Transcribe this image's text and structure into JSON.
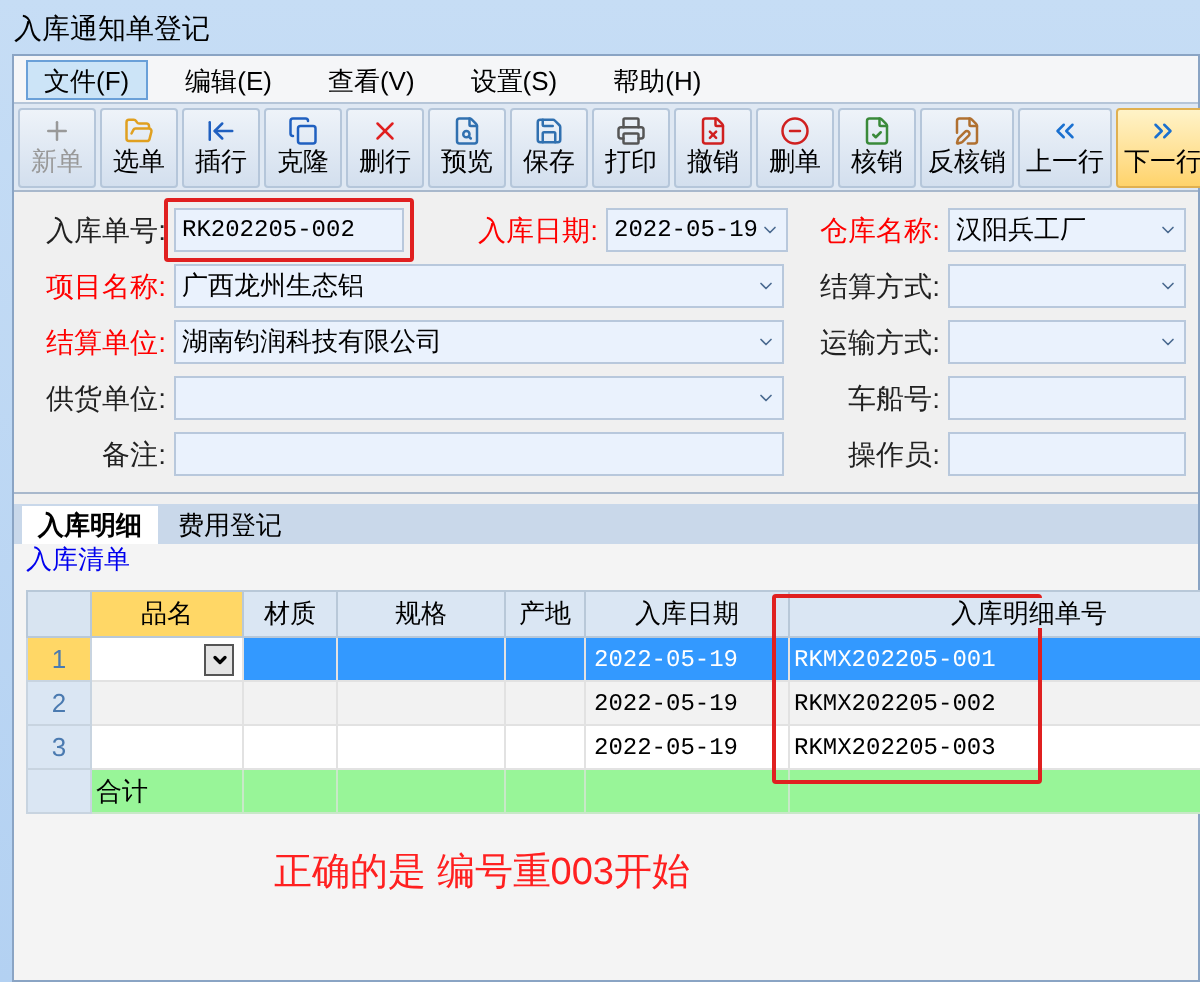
{
  "window": {
    "title": "入库通知单登记"
  },
  "menu": [
    {
      "label": "文件(F)",
      "selected": true
    },
    {
      "label": "编辑(E)",
      "selected": false
    },
    {
      "label": "查看(V)",
      "selected": false
    },
    {
      "label": "设置(S)",
      "selected": false
    },
    {
      "label": "帮助(H)",
      "selected": false
    }
  ],
  "toolbar": [
    {
      "label": "新单",
      "kind": "new",
      "disabled": true,
      "selected": false
    },
    {
      "label": "选单",
      "kind": "folder",
      "disabled": false,
      "selected": false
    },
    {
      "label": "插行",
      "kind": "insert",
      "disabled": false,
      "selected": false
    },
    {
      "label": "克隆",
      "kind": "clone",
      "disabled": false,
      "selected": false
    },
    {
      "label": "删行",
      "kind": "delrow",
      "disabled": false,
      "selected": false
    },
    {
      "label": "预览",
      "kind": "preview",
      "disabled": false,
      "selected": false
    },
    {
      "label": "保存",
      "kind": "save",
      "disabled": false,
      "selected": false
    },
    {
      "label": "打印",
      "kind": "print",
      "disabled": false,
      "selected": false
    },
    {
      "label": "撤销",
      "kind": "undo",
      "disabled": false,
      "selected": false
    },
    {
      "label": "删单",
      "kind": "delete",
      "disabled": false,
      "selected": false
    },
    {
      "label": "核销",
      "kind": "verify",
      "disabled": false,
      "selected": false
    },
    {
      "label": "反核销",
      "kind": "unverify",
      "disabled": false,
      "selected": false
    },
    {
      "label": "上一行",
      "kind": "prev",
      "disabled": false,
      "selected": false
    },
    {
      "label": "下一行",
      "kind": "next",
      "disabled": false,
      "selected": true
    }
  ],
  "form": {
    "rows": [
      {
        "fields": [
          {
            "label": "入库单号:",
            "required": false,
            "value": "RK202205-002",
            "kind": "text",
            "boxed": true
          },
          {
            "label": "入库日期:",
            "required": true,
            "value": "2022-05-19",
            "kind": "combo",
            "boxed": false
          }
        ],
        "side": {
          "label": "仓库名称:",
          "required": true,
          "value": "汉阳兵工厂",
          "kind": "combo"
        }
      },
      {
        "fields": [
          {
            "label": "项目名称:",
            "required": true,
            "value": "广西龙州生态铝",
            "kind": "combo"
          }
        ],
        "side": {
          "label": "结算方式:",
          "required": false,
          "kind": "combo"
        }
      },
      {
        "fields": [
          {
            "label": "结算单位:",
            "required": true,
            "value": "湖南钧润科技有限公司",
            "kind": "combo"
          }
        ],
        "side": {
          "label": "运输方式:",
          "required": false,
          "kind": "combo"
        }
      },
      {
        "fields": [
          {
            "label": "供货单位:",
            "required": false,
            "kind": "combo"
          }
        ],
        "side": {
          "label": "车船号:",
          "required": false,
          "kind": "text"
        }
      },
      {
        "fields": [
          {
            "label": "备注:",
            "required": false,
            "kind": "text"
          }
        ],
        "side": {
          "label": "操作员:",
          "required": false,
          "kind": "text"
        }
      }
    ]
  },
  "tabs": [
    {
      "label": "入库明细",
      "selected": true
    },
    {
      "label": "费用登记",
      "selected": false
    }
  ],
  "group": {
    "title": "入库清单"
  },
  "table": {
    "columns": [
      {
        "label": "品名",
        "selected": true
      },
      {
        "label": "材质",
        "selected": false
      },
      {
        "label": "规格",
        "selected": false
      },
      {
        "label": "产地",
        "selected": false
      },
      {
        "label": "入库日期",
        "selected": false,
        "boxed": false
      },
      {
        "label": "入库明细单号",
        "selected": false,
        "boxed": true
      }
    ],
    "rows": [
      {
        "number": "1",
        "selected": true,
        "cells": [
          "",
          "",
          "",
          "",
          "2022-05-19",
          "RKMX202205-001"
        ]
      },
      {
        "number": "2",
        "selected": false,
        "cells": [
          "",
          "",
          "",
          "",
          "2022-05-19",
          "RKMX202205-002"
        ]
      },
      {
        "number": "3",
        "selected": false,
        "cells": [
          "",
          "",
          "",
          "",
          "2022-05-19",
          "RKMX202205-003"
        ]
      }
    ],
    "total": {
      "label": "合计"
    }
  },
  "note": "正确的是 编号重003开始"
}
